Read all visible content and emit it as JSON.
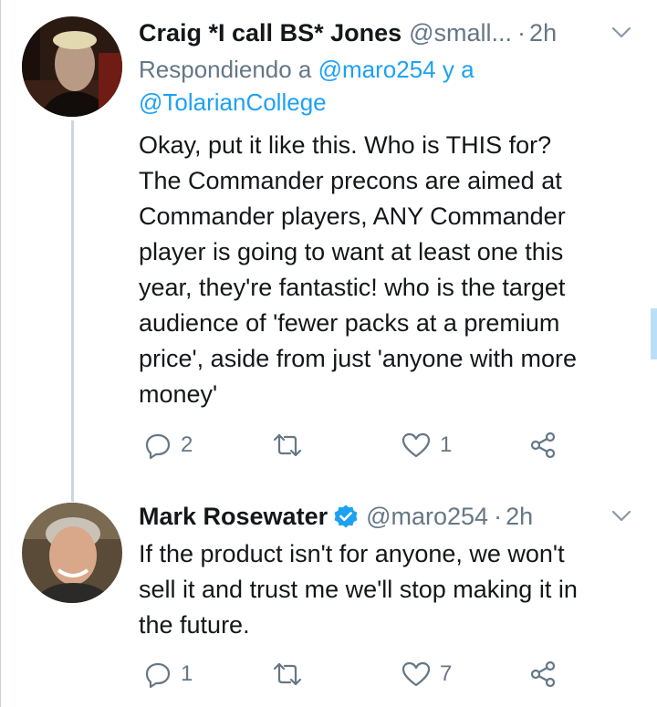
{
  "colors": {
    "text": "#14171a",
    "secondary": "#657786",
    "link": "#1da1f2",
    "verified": "#1da1f2",
    "thread_line": "#ccd6dd"
  },
  "tweets": [
    {
      "name": "Craig *I call BS* Jones",
      "handle": "@small...",
      "dot": "·",
      "time": "2h",
      "reply_prefix": "Respondiendo a",
      "reply_mention1": "@maro254",
      "reply_joiner": "y a",
      "reply_mention2": "@TolarianCollege",
      "text_lines": [
        "Okay, put it like this. Who is THIS for?",
        "The Commander precons are aimed at",
        "Commander players, ANY Commander",
        "player is going to want at least one this",
        "year, they're fantastic! who is the target",
        "audience of 'fewer packs at a premium",
        "price', aside from just 'anyone with more",
        "money'"
      ],
      "reply_count": "2",
      "retweet_count": "",
      "like_count": "1"
    },
    {
      "name": "Mark Rosewater",
      "verified_icon": "verified-badge-icon",
      "handle": "@maro254",
      "dot": "·",
      "time": "2h",
      "text_lines": [
        "If the product isn't for anyone, we won't",
        "sell it and trust me we'll stop making it in",
        "the future."
      ],
      "reply_count": "1",
      "retweet_count": "",
      "like_count": "7"
    }
  ]
}
